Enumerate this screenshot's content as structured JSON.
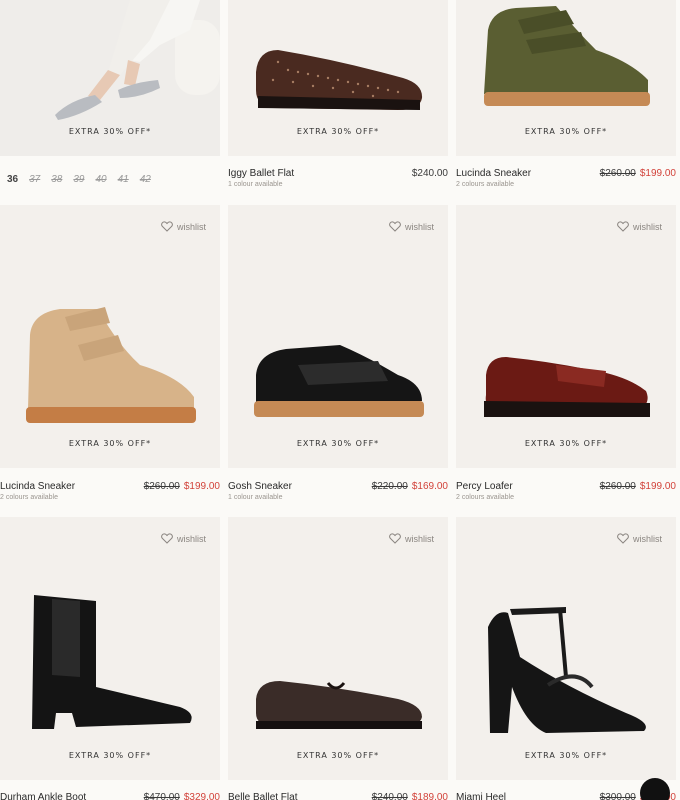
{
  "badge_text": "EXTRA 30% OFF*",
  "wishlist_label": "wishlist",
  "sizes": [
    "36",
    "37",
    "38",
    "39",
    "40",
    "41",
    "42"
  ],
  "products": [
    {
      "name": "",
      "availability": "",
      "old_price": "",
      "price": ""
    },
    {
      "name": "Iggy Ballet Flat",
      "availability": "1 colour available",
      "old_price": "",
      "price": "$240.00"
    },
    {
      "name": "Lucinda Sneaker",
      "availability": "2 colours available",
      "old_price": "$260.00",
      "price": "$199.00"
    },
    {
      "name": "Lucinda Sneaker",
      "availability": "2 colours available",
      "old_price": "$260.00",
      "price": "$199.00"
    },
    {
      "name": "Gosh Sneaker",
      "availability": "1 colour available",
      "old_price": "$220.00",
      "price": "$169.00"
    },
    {
      "name": "Percy Loafer",
      "availability": "2 colours available",
      "old_price": "$260.00",
      "price": "$199.00"
    },
    {
      "name": "Durham Ankle Boot",
      "availability": "",
      "old_price": "$470.00",
      "price": "$329.00"
    },
    {
      "name": "Belle Ballet Flat",
      "availability": "",
      "old_price": "$240.00",
      "price": "$189.00"
    },
    {
      "name": "Miami Heel",
      "availability": "",
      "old_price": "$300.00",
      "price": "$210.00"
    }
  ],
  "colors": {
    "sale": "#d2423a",
    "tile": "#f3f0ec",
    "page": "#fbfaf7"
  }
}
